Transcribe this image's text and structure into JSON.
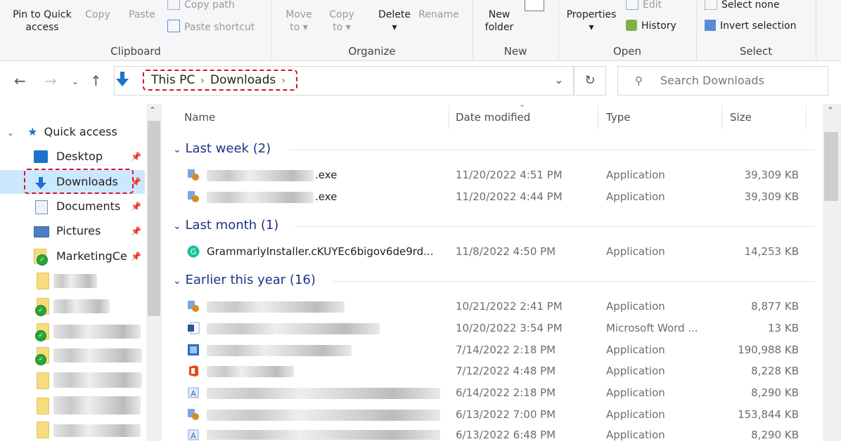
{
  "ribbon": {
    "clipboard": {
      "label": "Clipboard",
      "pin": "Pin to Quick access",
      "copy": "Copy",
      "paste": "Paste",
      "copy_path": "Copy path",
      "paste_shortcut": "Paste shortcut"
    },
    "organize": {
      "label": "Organize",
      "move_to": "Move to",
      "copy_to": "Copy to",
      "delete": "Delete",
      "rename": "Rename"
    },
    "new": {
      "label": "New",
      "new_folder": "New folder"
    },
    "open": {
      "label": "Open",
      "properties": "Properties",
      "edit": "Edit",
      "history": "History"
    },
    "select": {
      "label": "Select",
      "select_none": "Select none",
      "invert_selection": "Invert selection"
    }
  },
  "address": {
    "crumbs": [
      "This PC",
      "Downloads"
    ],
    "search_placeholder": "Search Downloads"
  },
  "sidebar": {
    "quick_access": "Quick access",
    "items": [
      {
        "label": "Desktop",
        "icon": "desktop-icon"
      },
      {
        "label": "Downloads",
        "icon": "download-arrow-icon"
      },
      {
        "label": "Documents",
        "icon": "documents-icon"
      },
      {
        "label": "Pictures",
        "icon": "pictures-icon"
      },
      {
        "label": "MarketingCe",
        "icon": "folder-sync-icon"
      }
    ]
  },
  "columns": {
    "name": "Name",
    "date": "Date modified",
    "type": "Type",
    "size": "Size"
  },
  "groups": [
    {
      "title": "Last week (2)",
      "rows": [
        {
          "name": ".exe",
          "date": "11/20/2022 4:51 PM",
          "type": "Application",
          "size": "39,309 KB"
        },
        {
          "name": ".exe",
          "date": "11/20/2022 4:44 PM",
          "type": "Application",
          "size": "39,309 KB"
        }
      ]
    },
    {
      "title": "Last month (1)",
      "rows": [
        {
          "name": "GrammarlyInstaller.cKUYEc6bigov6de9rd...",
          "date": "11/8/2022 4:50 PM",
          "type": "Application",
          "size": "14,253 KB"
        }
      ]
    },
    {
      "title": "Earlier this year (16)",
      "rows": [
        {
          "name": "",
          "date": "10/21/2022 2:41 PM",
          "type": "Application",
          "size": "8,877 KB"
        },
        {
          "name": "",
          "date": "10/20/2022 3:54 PM",
          "type": "Microsoft Word ...",
          "size": "13 KB"
        },
        {
          "name": "",
          "date": "7/14/2022 2:18 PM",
          "type": "Application",
          "size": "190,988 KB"
        },
        {
          "name": "",
          "date": "7/12/2022 4:48 PM",
          "type": "Application",
          "size": "8,228 KB"
        },
        {
          "name": "",
          "date": "6/14/2022 2:18 PM",
          "type": "Application",
          "size": "8,290 KB"
        },
        {
          "name": "",
          "date": "6/13/2022 7:00 PM",
          "type": "Application",
          "size": "153,844 KB"
        },
        {
          "name": "",
          "date": "6/13/2022 6:48 PM",
          "type": "Application",
          "size": "8,290 KB"
        }
      ]
    }
  ],
  "colors": {
    "accent": "#0078d7",
    "highlight": "#cce8ff",
    "annotation": "#d8141e",
    "group_title": "#1e3287"
  }
}
